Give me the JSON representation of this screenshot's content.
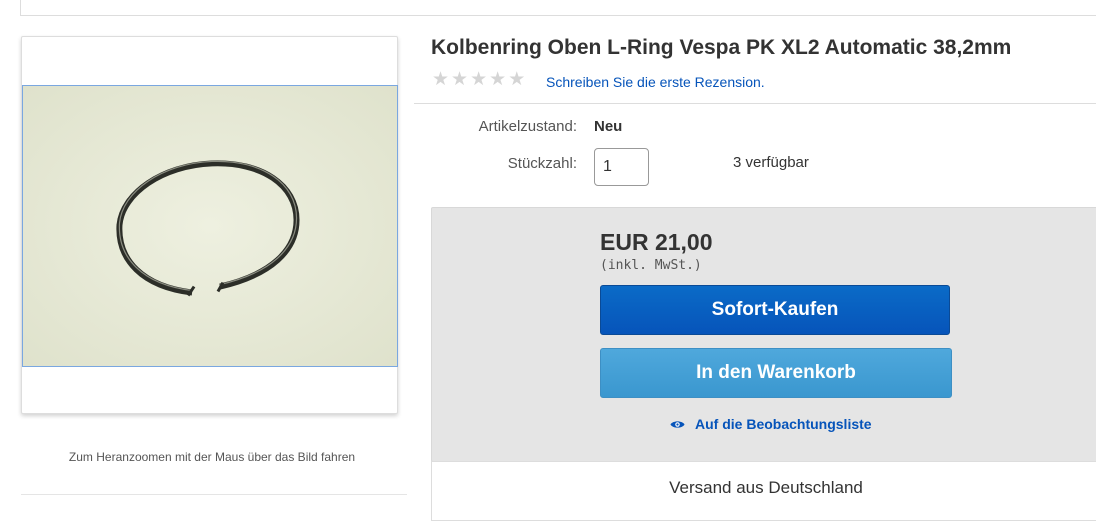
{
  "product": {
    "title": "Kolbenring Oben L-Ring Vespa PK XL2 Automatic 38,2mm",
    "rating": {
      "stars_filled": 0,
      "stars_total": 5
    },
    "review_link": "Schreiben Sie die erste Rezension.",
    "zoom_hint": "Zum Heranzoomen mit der Maus über das Bild fahren"
  },
  "details": {
    "condition_label": "Artikelzustand:",
    "condition_value": "Neu",
    "quantity_label": "Stückzahl:",
    "quantity_value": "1",
    "availability": "3 verfügbar"
  },
  "purchase": {
    "price": "EUR 21,00",
    "tax_note": "(inkl. MwSt.)",
    "buy_now_label": "Sofort-Kaufen",
    "add_to_cart_label": "In den Warenkorb",
    "watchlist_label": "Auf die Beobachtungsliste"
  },
  "shipping": {
    "text": "Versand aus Deutschland"
  },
  "colors": {
    "link": "#0654ba",
    "buy_button": "#0654ba",
    "cart_button": "#3a97cf",
    "panel_bg": "#e5e5e5"
  }
}
